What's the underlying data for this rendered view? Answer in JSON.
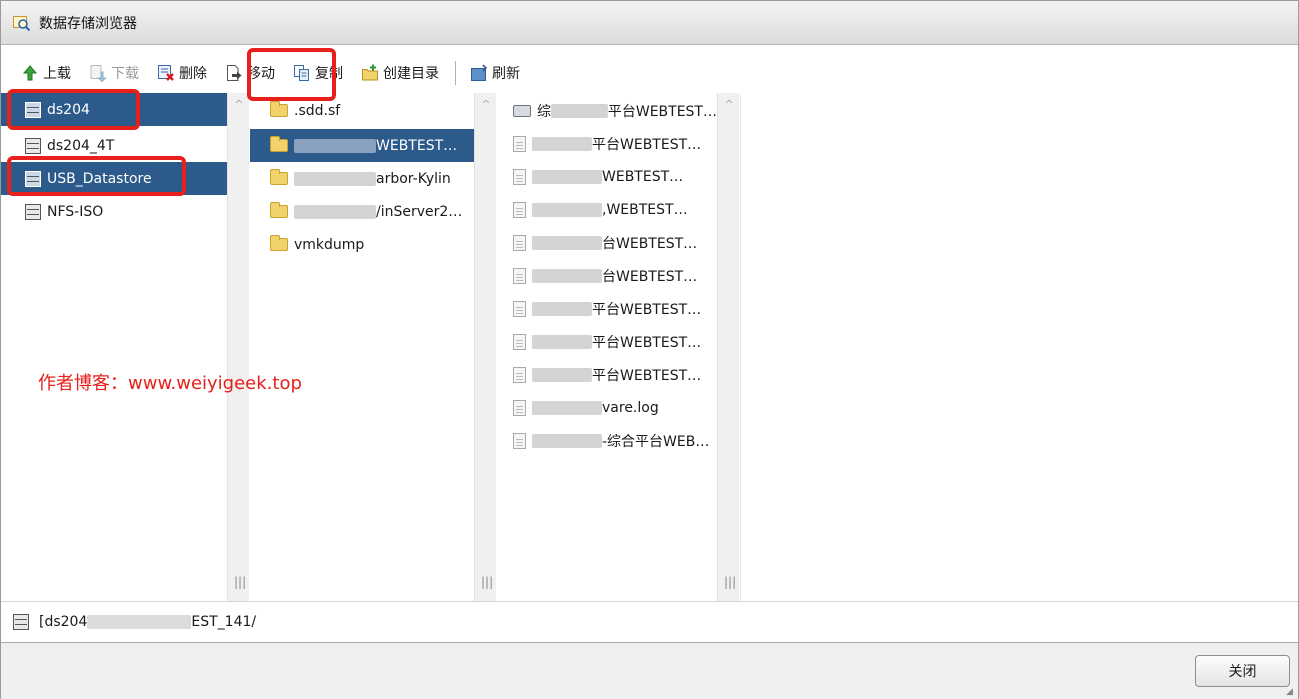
{
  "window": {
    "title": "数据存储浏览器"
  },
  "toolbar": {
    "upload": "上载",
    "download": "下载",
    "delete": "删除",
    "move": "移动",
    "copy": "复制",
    "create_dir": "创建目录",
    "refresh": "刷新"
  },
  "datastores": [
    {
      "label": "ds204",
      "selected": true
    },
    {
      "label": "ds204_4T",
      "selected": false
    },
    {
      "label": "USB_Datastore",
      "selected": true
    },
    {
      "label": "NFS-ISO",
      "selected": false
    }
  ],
  "folders": [
    {
      "label": ".sdd.sf",
      "selected": false
    },
    {
      "label": "WEBTEST…",
      "selected": true
    },
    {
      "label": "arbor-Kylin",
      "selected": false
    },
    {
      "label": "/inServer2…",
      "selected": false
    },
    {
      "label": "vmkdump",
      "selected": false
    }
  ],
  "files": [
    {
      "prefix": "综",
      "label": "平台WEBTEST…",
      "icon": "disk-icon"
    },
    {
      "prefix": "",
      "label": "平台WEBTEST…",
      "icon": "file-icon"
    },
    {
      "prefix": "",
      "label": "WEBTEST…",
      "icon": "file-icon"
    },
    {
      "prefix": "",
      "label": ",WEBTEST…",
      "icon": "file-icon"
    },
    {
      "prefix": "",
      "label": "台WEBTEST…",
      "icon": "file-icon"
    },
    {
      "prefix": "",
      "label": "台WEBTEST…",
      "icon": "file-icon"
    },
    {
      "prefix": "",
      "label": "平台WEBTEST…",
      "icon": "file-icon"
    },
    {
      "prefix": "",
      "label": "平台WEBTEST…",
      "icon": "file-icon"
    },
    {
      "prefix": "",
      "label": "平台WEBTEST…",
      "icon": "file-icon"
    },
    {
      "prefix": "",
      "label": "vare.log",
      "icon": "file-icon"
    },
    {
      "prefix": "",
      "label": "-综合平台WEB…",
      "icon": "file-icon"
    }
  ],
  "watermark": "作者博客：www.weiyigeek.top",
  "path": {
    "start": "[ds204",
    "end": "EST_141/"
  },
  "footer": {
    "close_label": "关闭"
  },
  "colors": {
    "selection": "#2c5a8b",
    "highlight": "#e8201c"
  }
}
